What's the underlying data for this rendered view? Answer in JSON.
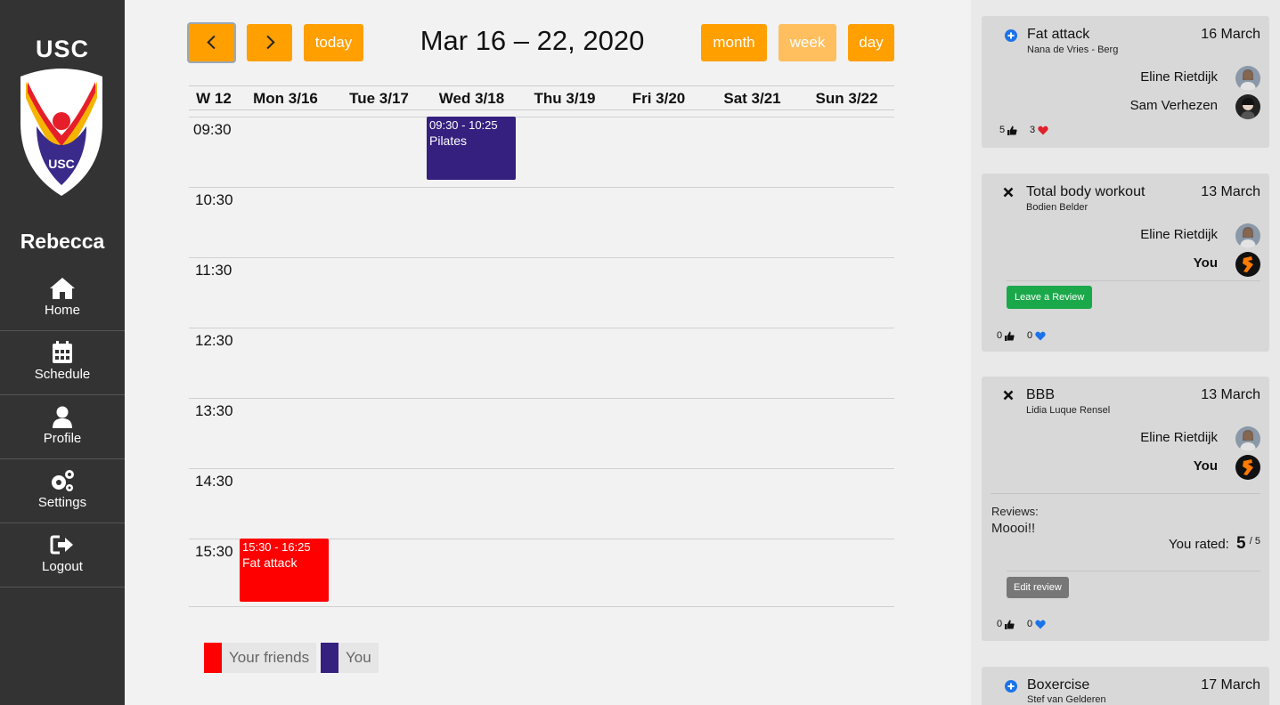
{
  "sidebar": {
    "brand": "USC",
    "logo_text": "USC",
    "username": "Rebecca",
    "items": [
      {
        "label": "Home",
        "icon": "home-icon"
      },
      {
        "label": "Schedule",
        "icon": "calendar-icon"
      },
      {
        "label": "Profile",
        "icon": "user-icon"
      },
      {
        "label": "Settings",
        "icon": "gears-icon"
      },
      {
        "label": "Logout",
        "icon": "logout-icon"
      }
    ]
  },
  "calendar": {
    "title": "Mar 16 – 22, 2020",
    "today_label": "today",
    "views": {
      "month": "month",
      "week": "week",
      "day": "day"
    },
    "active_view": "week",
    "week_label": "W 12",
    "days": [
      "Mon 3/16",
      "Tue 3/17",
      "Wed 3/18",
      "Thu 3/19",
      "Fri 3/20",
      "Sat 3/21",
      "Sun 3/22"
    ],
    "times": [
      "09:30",
      "10:30",
      "11:30",
      "12:30",
      "13:30",
      "14:30",
      "15:30"
    ],
    "events": [
      {
        "time": "09:30 - 10:25",
        "title": "Pilates",
        "day": "Wed 3/18",
        "color": "#35207f"
      },
      {
        "time": "15:30 - 16:25",
        "title": "Fat attack",
        "day": "Mon 3/16",
        "color": "#ff0000"
      }
    ],
    "legend": [
      {
        "label": "Your friends",
        "color": "#ff0000"
      },
      {
        "label": "You",
        "color": "#35207f"
      }
    ]
  },
  "colors": {
    "accent": "#ff9f00",
    "accent_light": "#ffbf5e",
    "sidebar_bg": "#333333",
    "friends": "#ff0000",
    "you": "#35207f",
    "review_green": "#1aa84a",
    "like_blue": "#1a73e8",
    "like_red": "#e0202a"
  },
  "feed": {
    "cards": [
      {
        "icon": "plus-circle-icon",
        "title": "Fat attack",
        "instructor": "Nana de Vries - Berg",
        "date": "16 March",
        "participants": [
          "Eline Rietdijk",
          "Sam Verhezen"
        ],
        "likes": "5",
        "hearts": "3"
      },
      {
        "icon": "close-icon",
        "title": "Total body workout",
        "instructor": "Bodien Belder",
        "date": "13 March",
        "participants": [
          "Eline Rietdijk",
          "You"
        ],
        "review_button": "Leave a Review",
        "likes": "0",
        "hearts": "0"
      },
      {
        "icon": "close-icon",
        "title": "BBB",
        "instructor": "Lidia Luque Rensel",
        "date": "13 March",
        "participants": [
          "Eline Rietdijk",
          "You"
        ],
        "reviews_label": "Reviews:",
        "review_text": "Moooi!!",
        "rated_label": "You rated:",
        "rating": "5",
        "rating_max": "/ 5",
        "edit_button": "Edit review",
        "likes": "0",
        "hearts": "0"
      },
      {
        "icon": "plus-circle-icon",
        "title": "Boxercise",
        "instructor": "Stef van Gelderen",
        "date": "17 March"
      }
    ]
  }
}
